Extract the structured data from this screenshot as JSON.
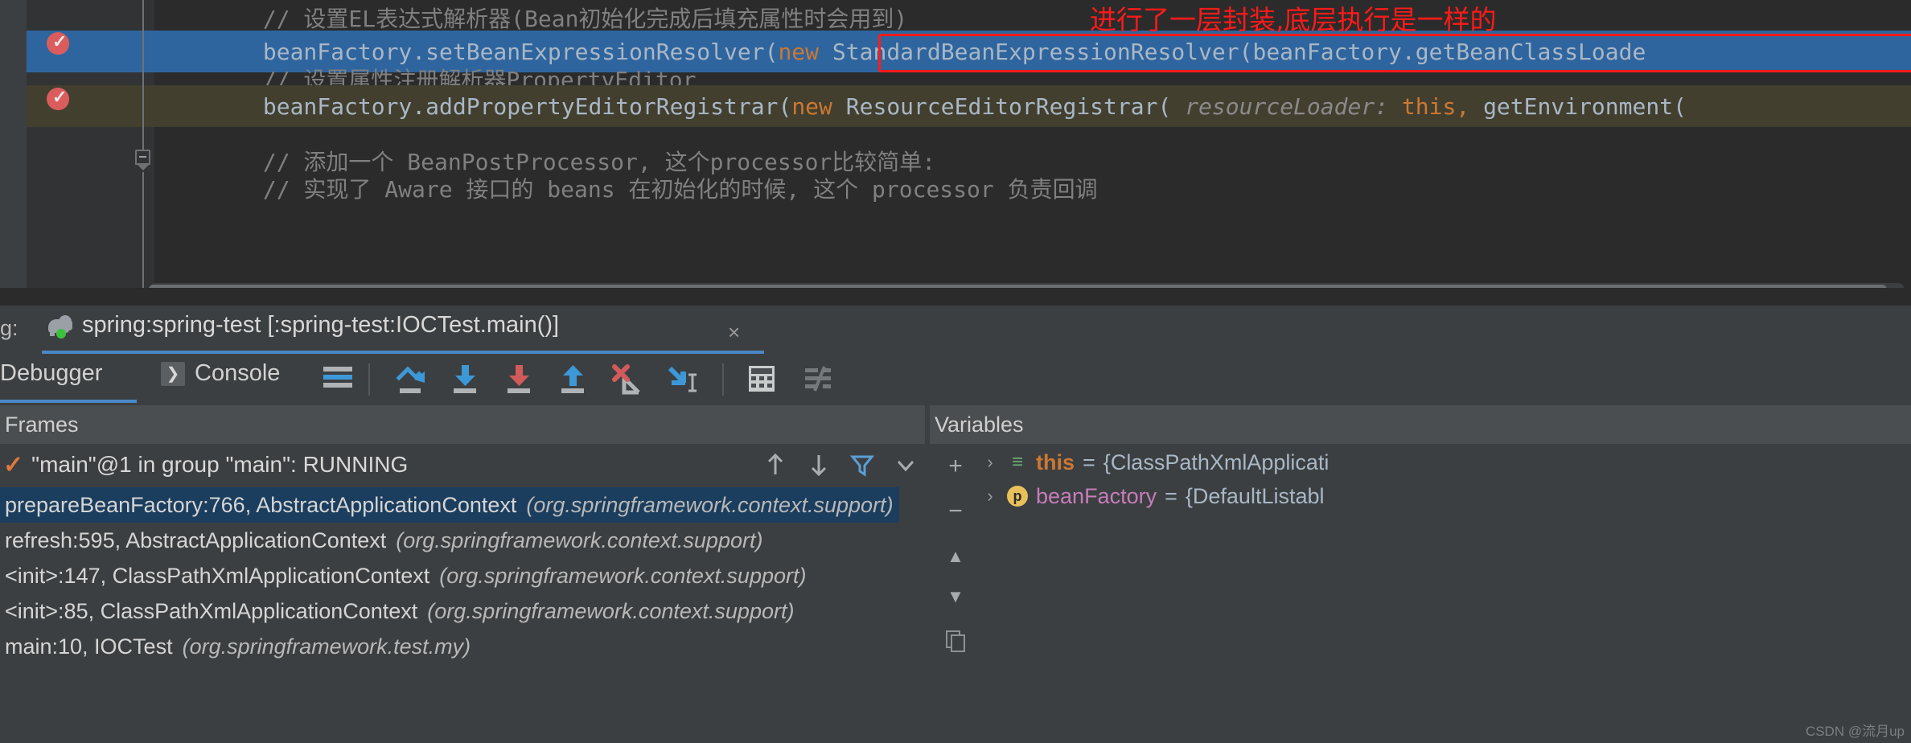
{
  "editor": {
    "lines": [
      {
        "id": "comment-el",
        "indent": 8,
        "text": "// 设置EL表达式解析器(Bean初始化完成后填充属性时会用到)",
        "kind": "comment"
      },
      {
        "id": "set-bean-expression-resolver",
        "indent": 8,
        "prefix": "beanFactory.setBeanExpressionResolver(",
        "keyword": "new",
        "rest": " StandardBeanExpressionResolver(beanFactory.getBeanClassLoade",
        "kind": "code-highlighted"
      },
      {
        "id": "comment-property-editor",
        "indent": 8,
        "text": "// 设置属性注册解析器PropertyEditor",
        "kind": "comment"
      },
      {
        "id": "add-property-editor-registrar",
        "indent": 8,
        "prefix": "beanFactory.addPropertyEditorRegistrar(",
        "keyword": "new",
        "mid": " ResourceEditorRegistrar( ",
        "param": "resourceLoader:",
        "thisKw": " this,",
        "rest": " getEnvironment(",
        "kind": "code-brown"
      },
      {
        "id": "comment-beanpostprocessor",
        "indent": 8,
        "text": "// 添加一个 BeanPostProcessor, 这个processor比较简单:",
        "kind": "comment"
      },
      {
        "id": "comment-aware-partial",
        "indent": 8,
        "text": "// 实现了 Aware 接口的 beans 在初始化的时候, 这个 processor 负责回调",
        "kind": "comment"
      }
    ],
    "annotations": {
      "red_text": "进行了一层封装,底层执行是一样的",
      "red_box_label": "highlight-rect"
    }
  },
  "debug_window": {
    "run_tab": {
      "prefix_label": "g:",
      "title": "spring:spring-test [:spring-test:IOCTest.main()]",
      "close_label": "×",
      "icon": "gradle-elephant-icon",
      "status": "running"
    },
    "tabs": [
      {
        "id": "debugger",
        "label": "Debugger",
        "active": true
      },
      {
        "id": "console",
        "label": "Console",
        "active": false
      }
    ],
    "toolbar": [
      {
        "id": "show-execution-point",
        "name": "show-execution-point-icon",
        "tooltip": "Show Execution Point"
      },
      {
        "id": "step-over",
        "name": "step-over-icon",
        "tooltip": "Step Over"
      },
      {
        "id": "step-into",
        "name": "step-into-icon",
        "tooltip": "Step Into"
      },
      {
        "id": "force-step-into",
        "name": "force-step-into-icon",
        "tooltip": "Force Step Into"
      },
      {
        "id": "step-out",
        "name": "step-out-icon",
        "tooltip": "Step Out"
      },
      {
        "id": "drop-frame",
        "name": "drop-frame-icon",
        "tooltip": "Drop Frame"
      },
      {
        "id": "run-to-cursor",
        "name": "run-to-cursor-icon",
        "tooltip": "Run to Cursor"
      },
      {
        "id": "evaluate-expression",
        "name": "evaluate-expression-icon",
        "tooltip": "Evaluate Expression"
      },
      {
        "id": "settings",
        "name": "debugger-settings-icon",
        "tooltip": "Settings"
      }
    ],
    "frames_panel": {
      "header": "Frames",
      "thread": "\"main\"@1 in group \"main\": RUNNING",
      "frames": [
        {
          "method": "prepareBeanFactory:766, AbstractApplicationContext",
          "package": "(org.springframework.context.support)",
          "selected": true
        },
        {
          "method": "refresh:595, AbstractApplicationContext",
          "package": "(org.springframework.context.support)",
          "selected": false
        },
        {
          "method": "<init>:147, ClassPathXmlApplicationContext",
          "package": "(org.springframework.context.support)",
          "selected": false
        },
        {
          "method": "<init>:85, ClassPathXmlApplicationContext",
          "package": "(org.springframework.context.support)",
          "selected": false
        },
        {
          "method": "main:10, IOCTest",
          "package": "(org.springframework.test.my)",
          "selected": false
        }
      ],
      "nav_icons": [
        {
          "id": "frames-up",
          "name": "arrow-up-icon",
          "glyph": "↑"
        },
        {
          "id": "frames-down",
          "name": "arrow-down-icon",
          "glyph": "↓"
        },
        {
          "id": "frames-filter",
          "name": "filter-icon",
          "glyph": "filter"
        },
        {
          "id": "frames-more",
          "name": "chevron-down-icon",
          "glyph": "▾"
        }
      ]
    },
    "variables_panel": {
      "header": "Variables",
      "gutter_buttons": [
        {
          "id": "add-watch",
          "name": "plus-icon",
          "glyph": "+"
        },
        {
          "id": "remove-watch",
          "name": "minus-icon",
          "glyph": "−"
        },
        {
          "id": "move-up",
          "name": "triangle-up-icon",
          "glyph": "▲"
        },
        {
          "id": "move-down",
          "name": "triangle-down-icon",
          "glyph": "▼"
        },
        {
          "id": "copy-value",
          "name": "copy-icon",
          "glyph": "copy"
        }
      ],
      "variables": [
        {
          "arrow": "›",
          "badge": "≡",
          "badge_kind": "this",
          "name": "this",
          "eq": " = ",
          "value": "{ClassPathXmlApplicati"
        },
        {
          "arrow": "›",
          "badge": "p",
          "badge_kind": "field",
          "name": "beanFactory",
          "eq": " = ",
          "value": "{DefaultListabl"
        }
      ]
    }
  },
  "watermark": "CSDN @流月up",
  "colors": {
    "editor_bg": "#2b2b2b",
    "gutter_bg": "#313335",
    "panel_bg": "#3c3f41",
    "selection_blue": "#2f659e",
    "frame_selected": "#1c3e5e",
    "accent_blue": "#4a88c7",
    "annotation_red": "#ff1a1a",
    "comment_grey": "#808080",
    "keyword_orange": "#cc7832",
    "code_fg": "#a9b7c6",
    "breakpoint_red": "#db5c5c",
    "running_green": "#3cc13c"
  }
}
